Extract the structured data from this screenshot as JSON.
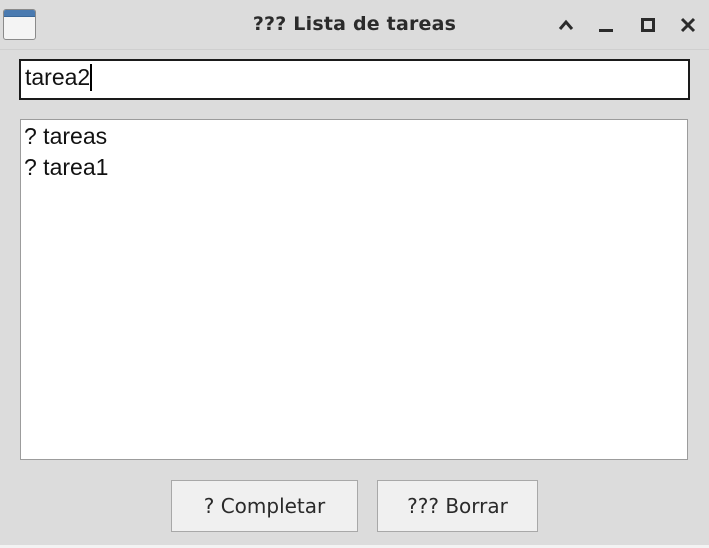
{
  "window": {
    "title": "??? Lista de tareas",
    "controls": {
      "collapse": "chevron-up-icon",
      "minimize": "minimize-icon",
      "maximize": "maximize-icon",
      "close": "close-icon"
    }
  },
  "entry": {
    "value": "tarea2"
  },
  "list": {
    "items": [
      "? tareas",
      "? tarea1"
    ]
  },
  "buttons": {
    "complete_label": "? Completar",
    "delete_label": "??? Borrar"
  },
  "colors": {
    "window_bg": "#dcdcdc",
    "field_bg": "#ffffff",
    "text": "#111111",
    "icon_accent": "#4a7ab0"
  }
}
